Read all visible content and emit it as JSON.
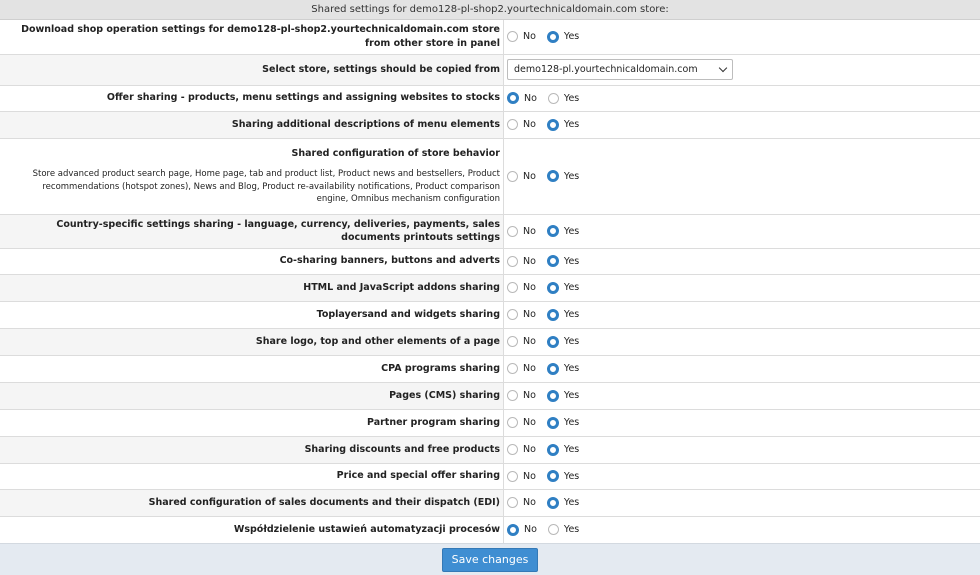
{
  "header": {
    "title": "Shared settings for demo128-pl-shop2.yourtechnicaldomain.com store:"
  },
  "options": {
    "no": "No",
    "yes": "Yes"
  },
  "store_select": {
    "label": "Select store, settings should be copied from",
    "value": "demo128-pl.yourtechnicaldomain.com"
  },
  "rows": [
    {
      "label": "Download shop operation settings for demo128-pl-shop2.yourtechnicaldomain.com store from other store in panel",
      "selected": "yes"
    },
    {
      "label": "Offer sharing - products, menu settings and assigning websites to stocks",
      "selected": "no"
    },
    {
      "label": "Sharing additional descriptions of menu elements",
      "selected": "yes"
    },
    {
      "label": "Shared configuration of store behavior",
      "description": "Store advanced product search page, Home page, tab and product list, Product news and bestsellers, Product recommendations (hotspot zones), News and Blog, Product re-availability notifications, Product comparison engine, Omnibus mechanism configuration",
      "selected": "yes"
    },
    {
      "label": "Country-specific settings sharing - language, currency, deliveries, payments, sales documents printouts settings",
      "selected": "yes"
    },
    {
      "label": "Co-sharing banners, buttons and adverts",
      "selected": "yes"
    },
    {
      "label": "HTML and JavaScript addons sharing",
      "selected": "yes"
    },
    {
      "label": "Toplayersand and widgets sharing",
      "selected": "yes"
    },
    {
      "label": "Share logo, top and other elements of a page",
      "selected": "yes"
    },
    {
      "label": "CPA programs sharing",
      "selected": "yes"
    },
    {
      "label": "Pages (CMS) sharing",
      "selected": "yes"
    },
    {
      "label": "Partner program sharing",
      "selected": "yes"
    },
    {
      "label": "Sharing discounts and free products",
      "selected": "yes"
    },
    {
      "label": "Price and special offer sharing",
      "selected": "yes"
    },
    {
      "label": "Shared configuration of sales documents and their dispatch (EDI)",
      "selected": "yes"
    },
    {
      "label": "Współdzielenie ustawień automatyzacji procesów",
      "selected": "no"
    }
  ],
  "footer": {
    "save_label": "Save changes"
  },
  "colors": {
    "accent": "#2f7fc3",
    "button": "#3f8ed2",
    "footer_bg": "#e4eaf1"
  }
}
